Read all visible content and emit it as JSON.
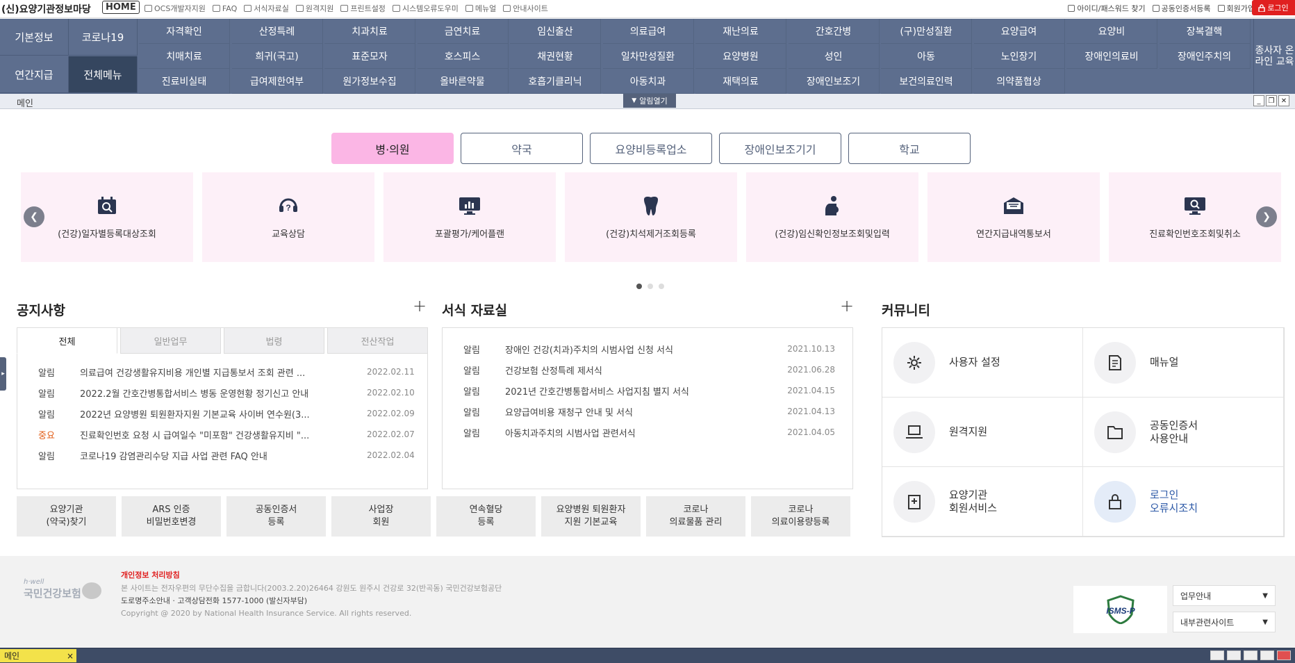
{
  "topbar": {
    "brand": "(신)요양기관정보마당",
    "home": "HOME",
    "links": [
      "OCS개발자지원",
      "FAQ",
      "서식자료실",
      "원격지원",
      "프린트설정",
      "시스템오류도우미",
      "메뉴얼",
      "안내사이트"
    ],
    "right_links": [
      "아이디/패스워드 찾기",
      "공동인증서등록",
      "회원가입"
    ],
    "login": "로그인"
  },
  "leftmenu": [
    "기본정보",
    "코로나19",
    "연간지급",
    "전체메뉴"
  ],
  "menu_rows": [
    [
      "자격확인",
      "산정특례",
      "치과치료",
      "금연치료",
      "임신출산",
      "의료급여",
      "재난의료",
      "간호간병",
      "(구)만성질환",
      "요양급여",
      "요양비",
      "장복결핵"
    ],
    [
      "치매치료",
      "희귀(국고)",
      "표준모자",
      "호스피스",
      "채권현황",
      "일차만성질환",
      "요양병원",
      "성인",
      "아동",
      "노인장기",
      "장애인의료비",
      "장애인주치의"
    ],
    [
      "진료비실태",
      "급여제한여부",
      "원가정보수집",
      "올바른약물",
      "호흡기클리닉",
      "아동치과",
      "재택의료",
      "장애인보조기",
      "보건의료인력",
      "의약품협상"
    ]
  ],
  "side_menu": "종사자 온라인 교육",
  "tabbar": {
    "current": "메인",
    "alert": "알림열기"
  },
  "segments": [
    "병·의원",
    "약국",
    "요양비등록업소",
    "장애인보조기기",
    "학교"
  ],
  "cards": [
    {
      "label": "(건강)일자별등록대상조회",
      "icon": "calendar-search-icon"
    },
    {
      "label": "교육상담",
      "icon": "headset-question-icon"
    },
    {
      "label": "포괄평가/케어플랜",
      "icon": "monitor-chart-icon"
    },
    {
      "label": "(건강)치석제거조회등록",
      "icon": "tooth-icon"
    },
    {
      "label": "(건강)임신확인정보조회및입력",
      "icon": "pregnant-icon"
    },
    {
      "label": "연간지급내역통보서",
      "icon": "mail-icon"
    },
    {
      "label": "진료확인번호조회및취소",
      "icon": "monitor-search-icon"
    }
  ],
  "notice": {
    "title": "공지사항",
    "tabs": [
      "전체",
      "일반업무",
      "법령",
      "전산작업"
    ],
    "rows": [
      {
        "cat": "알림",
        "title": "의료급여 건강생활유지비용 개인별 지급통보서 조회 관련 ...",
        "date": "2022.02.11",
        "imp": false
      },
      {
        "cat": "알림",
        "title": "2022.2월 간호간병통합서비스 병동 운영현황 정기신고 안내",
        "date": "2022.02.10",
        "imp": false
      },
      {
        "cat": "알림",
        "title": "2022년 요양병원 퇴원환자지원 기본교육 사이버 연수원(3...",
        "date": "2022.02.09",
        "imp": false
      },
      {
        "cat": "중요",
        "title": "진료확인번호 요청 시 급여일수 \"미포함\" 건강생활유지비 \"...",
        "date": "2022.02.07",
        "imp": true
      },
      {
        "cat": "알림",
        "title": "코로나19 감염관리수당 지급 사업 관련 FAQ 안내",
        "date": "2022.02.04",
        "imp": false
      }
    ]
  },
  "forms": {
    "title": "서식 자료실",
    "rows": [
      {
        "cat": "알림",
        "title": "장애인 건강(치과)주치의 시범사업 신청 서식",
        "date": "2021.10.13"
      },
      {
        "cat": "알림",
        "title": "건강보험 산정특례 제서식",
        "date": "2021.06.28"
      },
      {
        "cat": "알림",
        "title": "2021년 간호간병통합서비스 사업지침 별지 서식",
        "date": "2021.04.15"
      },
      {
        "cat": "알림",
        "title": "요양급여비용 재청구 안내 및 서식",
        "date": "2021.04.13"
      },
      {
        "cat": "알림",
        "title": "아동치과주치의 시범사업 관련서식",
        "date": "2021.04.05"
      }
    ]
  },
  "quick": [
    [
      "요양기관",
      "(약국)찾기"
    ],
    [
      "ARS 인증",
      "비밀번호변경"
    ],
    [
      "공동인증서",
      "등록"
    ],
    [
      "사업장",
      "회원"
    ],
    [
      "연속혈당",
      "등록"
    ],
    [
      "요양병원 퇴원환자",
      "지원 기본교육"
    ],
    [
      "코로나",
      "의료물품 관리"
    ],
    [
      "코로나",
      "의료이용량등록"
    ]
  ],
  "community": {
    "title": "커뮤니티",
    "items": [
      {
        "label": [
          "사용자 설정"
        ],
        "icon": "gear-icon"
      },
      {
        "label": [
          "매뉴얼"
        ],
        "icon": "document-icon"
      },
      {
        "label": [
          "원격지원"
        ],
        "icon": "laptop-icon"
      },
      {
        "label": [
          "공동인증서",
          "사용안내"
        ],
        "icon": "folder-icon"
      },
      {
        "label": [
          "요양기관",
          "회원서비스"
        ],
        "icon": "hospital-icon"
      },
      {
        "label": [
          "로그인",
          "오류시조치"
        ],
        "icon": "lock-icon",
        "blue": true
      }
    ]
  },
  "footer": {
    "logo_small": "h·well",
    "logo_big": "국민건강보험",
    "policy": "개인정보 처리방침",
    "line1": "본 사이트는 전자우편의 무단수집을 금합니다(2003.2.20)26464 강원도 원주시 건강로 32(반곡동) 국민건강보험공단",
    "line2": "도로명주소안내 · 고객상담전화 1577-1000 (발신자부담)",
    "line3": "Copyright @ 2020 by National Health Insurance Service. All rights reserved.",
    "isms": "ISMS-P",
    "select1": "업무안내",
    "select2": "내부관련사이트"
  },
  "statusbar": {
    "tab": "메인",
    "close": "×"
  },
  "colors": {
    "menu": "#5d6e8e",
    "accent": "#fbb6e5",
    "card": "#fdf0f8",
    "important": "#e15b14",
    "login": "#e02020"
  }
}
